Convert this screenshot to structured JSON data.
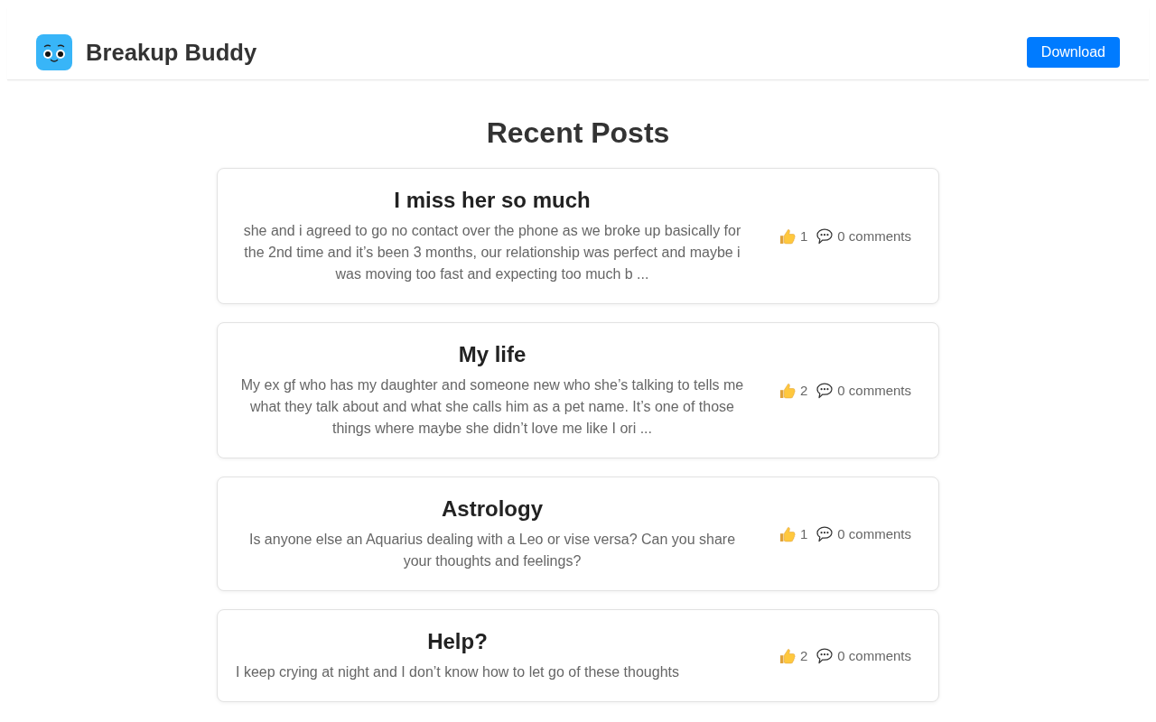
{
  "header": {
    "app_name": "Breakup Buddy",
    "download_button": "Download"
  },
  "heading": "Recent Posts",
  "posts": [
    {
      "title": "I miss her so much",
      "excerpt": "she and i agreed to go no contact over the phone as we broke up basically for the 2nd time and it’s been 3 months, our relationship was perfect and maybe i was moving too fast and expecting too much b ...",
      "likes": "1",
      "comments": "0 comments"
    },
    {
      "title": "My life",
      "excerpt": "My ex gf who has my daughter and someone new who she’s talking to tells me what they talk about and what she calls him as a pet name. It’s one of those things where maybe she didn’t love me like I ori ...",
      "likes": "2",
      "comments": "0 comments"
    },
    {
      "title": "Astrology",
      "excerpt": "Is anyone else an Aquarius dealing with a Leo or vise versa? Can you share your thoughts and feelings?",
      "likes": "1",
      "comments": "0 comments"
    },
    {
      "title": "Help?",
      "excerpt": "I keep crying at night and I don’t know how to let go of these thoughts",
      "likes": "2",
      "comments": "0 comments"
    }
  ]
}
